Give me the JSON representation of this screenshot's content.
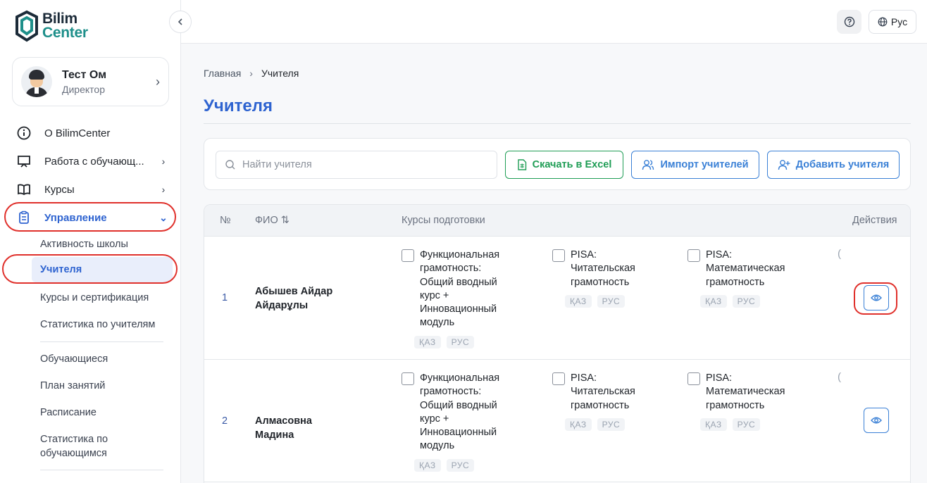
{
  "logo": {
    "line1": "Bilim",
    "line2": "Center"
  },
  "user": {
    "name": "Тест Ом",
    "role": "Директор"
  },
  "nav": {
    "about": "О BilimCenter",
    "work": "Работа с обучающ...",
    "courses": "Курсы",
    "management": "Управление"
  },
  "subnav": {
    "activity": "Активность школы",
    "teachers": "Учителя",
    "courses_cert": "Курсы и сертификация",
    "teacher_stats": "Статистика по учителям",
    "students": "Обучающиеся",
    "lesson_plan": "План занятий",
    "schedule": "Расписание",
    "student_stats": "Статистика по обучающимся"
  },
  "topbar": {
    "language": "Рус"
  },
  "breadcrumb": {
    "home": "Главная",
    "current": "Учителя"
  },
  "page": {
    "title": "Учителя"
  },
  "toolbar": {
    "search_placeholder": "Найти учителя",
    "excel": "Скачать в Excel",
    "import": "Импорт учителей",
    "add": "Добавить учителя"
  },
  "table": {
    "headers": {
      "num": "№",
      "fio": "ФИО ⇅",
      "courses": "Курсы подготовки",
      "actions": "Действия"
    },
    "rows": [
      {
        "num": "1",
        "name": "Абышев Айдар Айдарұлы",
        "courses": [
          {
            "title": "Функциональная грамотность: Общий вводный курс + Инновационный модуль",
            "tags": [
              "ҚАЗ",
              "РУС"
            ]
          },
          {
            "title": "PISA: Читательская грамотность",
            "tags": [
              "ҚАЗ",
              "РУС"
            ]
          },
          {
            "title": "PISA: Математическая грамотность",
            "tags": [
              "ҚАЗ",
              "РУС"
            ]
          }
        ]
      },
      {
        "num": "2",
        "name": "Алмасовна Мадина",
        "courses": [
          {
            "title": "Функциональная грамотность: Общий вводный курс + Инновационный модуль",
            "tags": [
              "ҚАЗ",
              "РУС"
            ]
          },
          {
            "title": "PISA: Читательская грамотность",
            "tags": [
              "ҚАЗ",
              "РУС"
            ]
          },
          {
            "title": "PISA: Математическая грамотность",
            "tags": [
              "ҚАЗ",
              "РУС"
            ]
          }
        ]
      }
    ]
  },
  "colors": {
    "primary": "#2e63d0",
    "excel_green": "#1f9d55",
    "outline_blue": "#3a80d6",
    "annotation_red": "#e0302b"
  },
  "icons": [
    "info-icon",
    "monitor-icon",
    "book-icon",
    "clipboard-icon",
    "chevron-right-icon",
    "chevron-down-icon",
    "chevron-left-icon",
    "help-icon",
    "globe-icon",
    "search-icon",
    "excel-icon",
    "users-icon",
    "user-plus-icon",
    "eye-icon"
  ]
}
